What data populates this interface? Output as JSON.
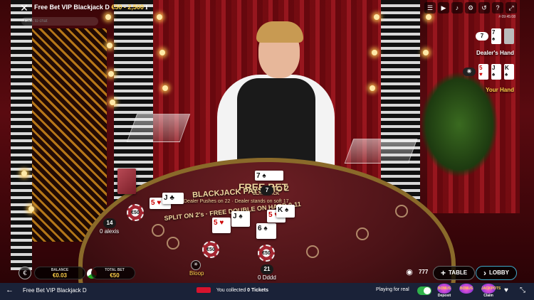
{
  "top_bar": {
    "game_title": "Free Bet VIP Blackjack D",
    "limits": "€50 - 2,500",
    "chat_placeholder": "Click to chat",
    "game_id": "# 09:45:08",
    "icons": [
      "chat-icon",
      "video-icon",
      "volume-icon",
      "settings-icon",
      "history-icon",
      "help-icon",
      "fullscreen-icon"
    ]
  },
  "table": {
    "brand_top": "FREE BET",
    "brand_sub": "BLACKJACK",
    "pays_line": "BLACKJACK PAYS 3 TO 2",
    "rule_line": "Dealer Pushes on 22 · Dealer stands on soft 17",
    "split_line": "SPLIT ON 2's · FREE DOUBLE ON HARD 9-11",
    "dealer_score": "7",
    "chip_value": "€50"
  },
  "seats": [
    {
      "name": "alexis",
      "score": "14",
      "prefix": "0"
    },
    {
      "name": "Bloop",
      "score": "",
      "prefix": ""
    },
    {
      "name": "Dddd",
      "score": "21",
      "prefix": "0"
    }
  ],
  "hands_panel": {
    "dealer_score": "7",
    "dealer_label": "Dealer's Hand",
    "dealer_cards": [
      {
        "rank": "7",
        "suit": "♠"
      }
    ],
    "your_label": "Your Hand",
    "your_cards": [
      {
        "rank": "5",
        "suit": "♥"
      },
      {
        "rank": "J",
        "suit": "♠"
      },
      {
        "rank": "K",
        "suit": "♠"
      }
    ]
  },
  "controls": {
    "currency_icon": "€",
    "balance_label": "BALANCE",
    "balance_value": "€0.03",
    "total_bet_label": "TOTAL BET",
    "total_bet_value": "€50",
    "table_button": "TABLE",
    "lobby_button": "LOBBY"
  },
  "nav": {
    "title": "Free Bet VIP Blackjack D",
    "tickets_text_pre": "You collected",
    "tickets_count": "0 Tickets",
    "playing_for_real": "Playing for real",
    "promos": [
      {
        "badge": "BONUS",
        "label": "Deposit"
      },
      {
        "badge": "BONUS",
        "label": ""
      },
      {
        "badge": "JACKPOTS",
        "label": "Claim"
      }
    ]
  },
  "colors": {
    "accent_gold": "#ffd24a",
    "nav_bg": "#1a2238",
    "toggle_on": "#2fb24a"
  }
}
